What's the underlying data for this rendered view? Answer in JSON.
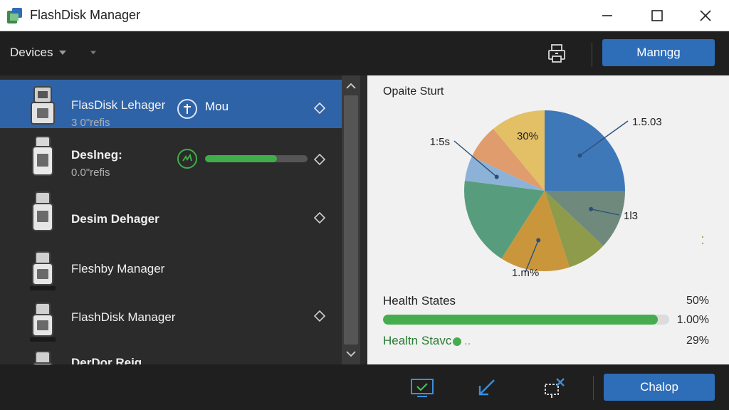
{
  "window": {
    "title": "FlashDisk Manager"
  },
  "toolbar": {
    "devices_label": "Devices",
    "manage_label": "Manngg"
  },
  "devices": [
    {
      "name": "FlasDisk Lehager",
      "sub": "3 0\"refis",
      "status": "Mou",
      "selected": true
    },
    {
      "name": "Deslneg:",
      "sub": "0.0\"refis",
      "progress": 0.7
    },
    {
      "name": "Desim Dehager"
    },
    {
      "name": "Fleshby Manager"
    },
    {
      "name": "FlashDisk Manager"
    },
    {
      "name": "DerDor Reig"
    }
  ],
  "chart_data": {
    "type": "pie",
    "title": "Opaite Sturt",
    "slices": [
      {
        "label": "1.5.03",
        "value": 25,
        "color": "#3f78b9"
      },
      {
        "label": "1l3",
        "value": 12,
        "color": "#6f8a7c"
      },
      {
        "label": "",
        "value": 8,
        "color": "#8e9b4a"
      },
      {
        "label": "1.m%",
        "value": 14,
        "color": "#c9963c"
      },
      {
        "label": "",
        "value": 18,
        "color": "#579d7d"
      },
      {
        "label": "1:5s",
        "value": 5,
        "color": "#8db2d8"
      },
      {
        "label": "",
        "value": 7,
        "color": "#e09c6c"
      },
      {
        "label": "30%",
        "value": 11,
        "color": "#e3bf66"
      }
    ]
  },
  "health": {
    "label": "Health States",
    "pct_top": "50%",
    "pct_bar": "1.00%",
    "bar_value": 0.96,
    "label2": "Healtn Stavc",
    "label2_suffix": "..",
    "pct2": "29%"
  },
  "bottom": {
    "cleanup_label": "Chalop"
  },
  "colors": {
    "accent": "#2e6db8",
    "selected_row": "#2f63a8",
    "green": "#46ad4f"
  }
}
